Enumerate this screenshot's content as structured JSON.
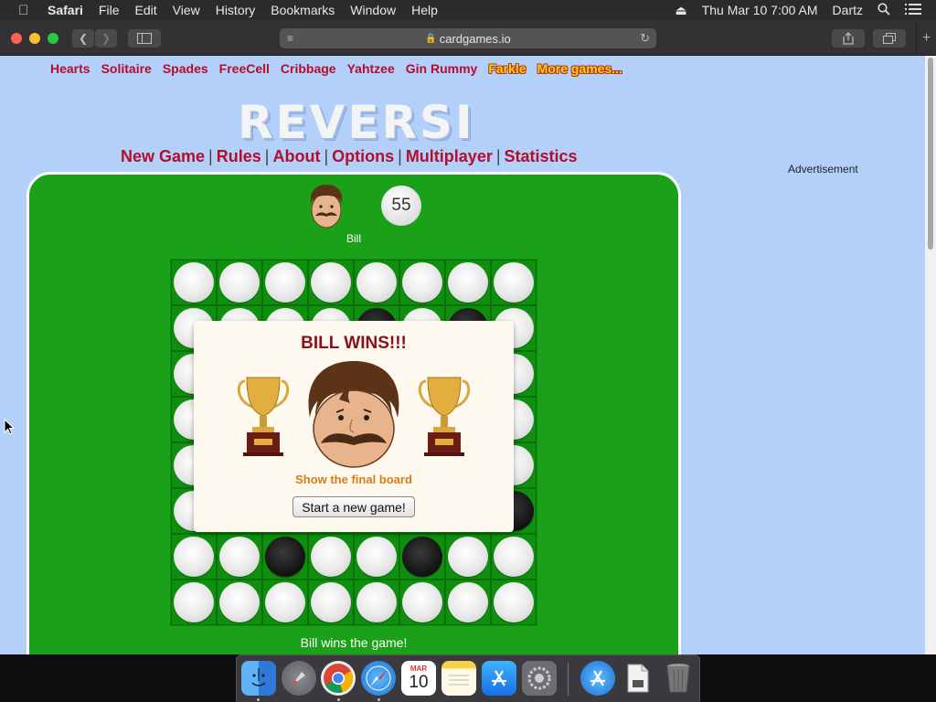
{
  "menubar": {
    "app": "Safari",
    "items": [
      "File",
      "Edit",
      "View",
      "History",
      "Bookmarks",
      "Window",
      "Help"
    ],
    "datetime": "Thu Mar 10  7:00 AM",
    "user": "Dartz"
  },
  "browser": {
    "url": "cardgames.io"
  },
  "site": {
    "top_links": [
      "Hearts",
      "Solitaire",
      "Spades",
      "FreeCell",
      "Cribbage",
      "Yahtzee",
      "Gin Rummy",
      "Farkle",
      "More games..."
    ],
    "logo": "REVERSI",
    "nav": [
      "New Game",
      "Rules",
      "About",
      "Options",
      "Multiplayer",
      "Statistics"
    ],
    "nav_separator": "|",
    "advertisement": "Advertisement"
  },
  "game": {
    "player_name": "Bill",
    "player_score": "55",
    "board": [
      [
        "W",
        "W",
        "W",
        "W",
        "W",
        "W",
        "W",
        "W"
      ],
      [
        "W",
        "W",
        "W",
        "W",
        "B",
        "W",
        "B",
        "W"
      ],
      [
        "W",
        "W",
        "W",
        "W",
        "W",
        "W",
        "W",
        "W"
      ],
      [
        "W",
        "W",
        "W",
        "W",
        "W",
        "W",
        "W",
        "W"
      ],
      [
        "W",
        "W",
        "W",
        "W",
        "W",
        "W",
        "W",
        "W"
      ],
      [
        "W",
        "W",
        "W",
        "W",
        "W",
        "W",
        "W",
        "B"
      ],
      [
        "W",
        "W",
        "B",
        "W",
        "W",
        "B",
        "W",
        "W"
      ],
      [
        "W",
        "W",
        "W",
        "W",
        "W",
        "W",
        "W",
        "W"
      ]
    ],
    "status": "Bill wins the game!"
  },
  "dialog": {
    "title": "BILL WINS!!!",
    "show_board": "Show the final board",
    "new_game_button": "Start a new game!"
  },
  "dock": {
    "calendar_month": "MAR",
    "calendar_day": "10"
  },
  "colors": {
    "felt": "#1ba01a",
    "page_bg": "#b2d0f9",
    "link_red": "#b50e2b",
    "win_title": "#8a0e1b",
    "show_board": "#d97b12"
  },
  "icons": {
    "menubar": [
      "apple-icon",
      "eject-icon",
      "search-icon",
      "list-icon"
    ],
    "toolbar": [
      "back-icon",
      "forward-icon",
      "sidebar-icon",
      "reader-icon",
      "lock-icon",
      "reload-icon",
      "share-icon",
      "tabs-icon",
      "new-tab-icon"
    ],
    "dock": [
      "finder-icon",
      "launchpad-icon",
      "chrome-icon",
      "safari-icon",
      "calendar-icon",
      "notes-icon",
      "app-store-icon",
      "system-preferences-icon",
      "app-store-download-icon",
      "file-icon",
      "trash-icon"
    ]
  }
}
